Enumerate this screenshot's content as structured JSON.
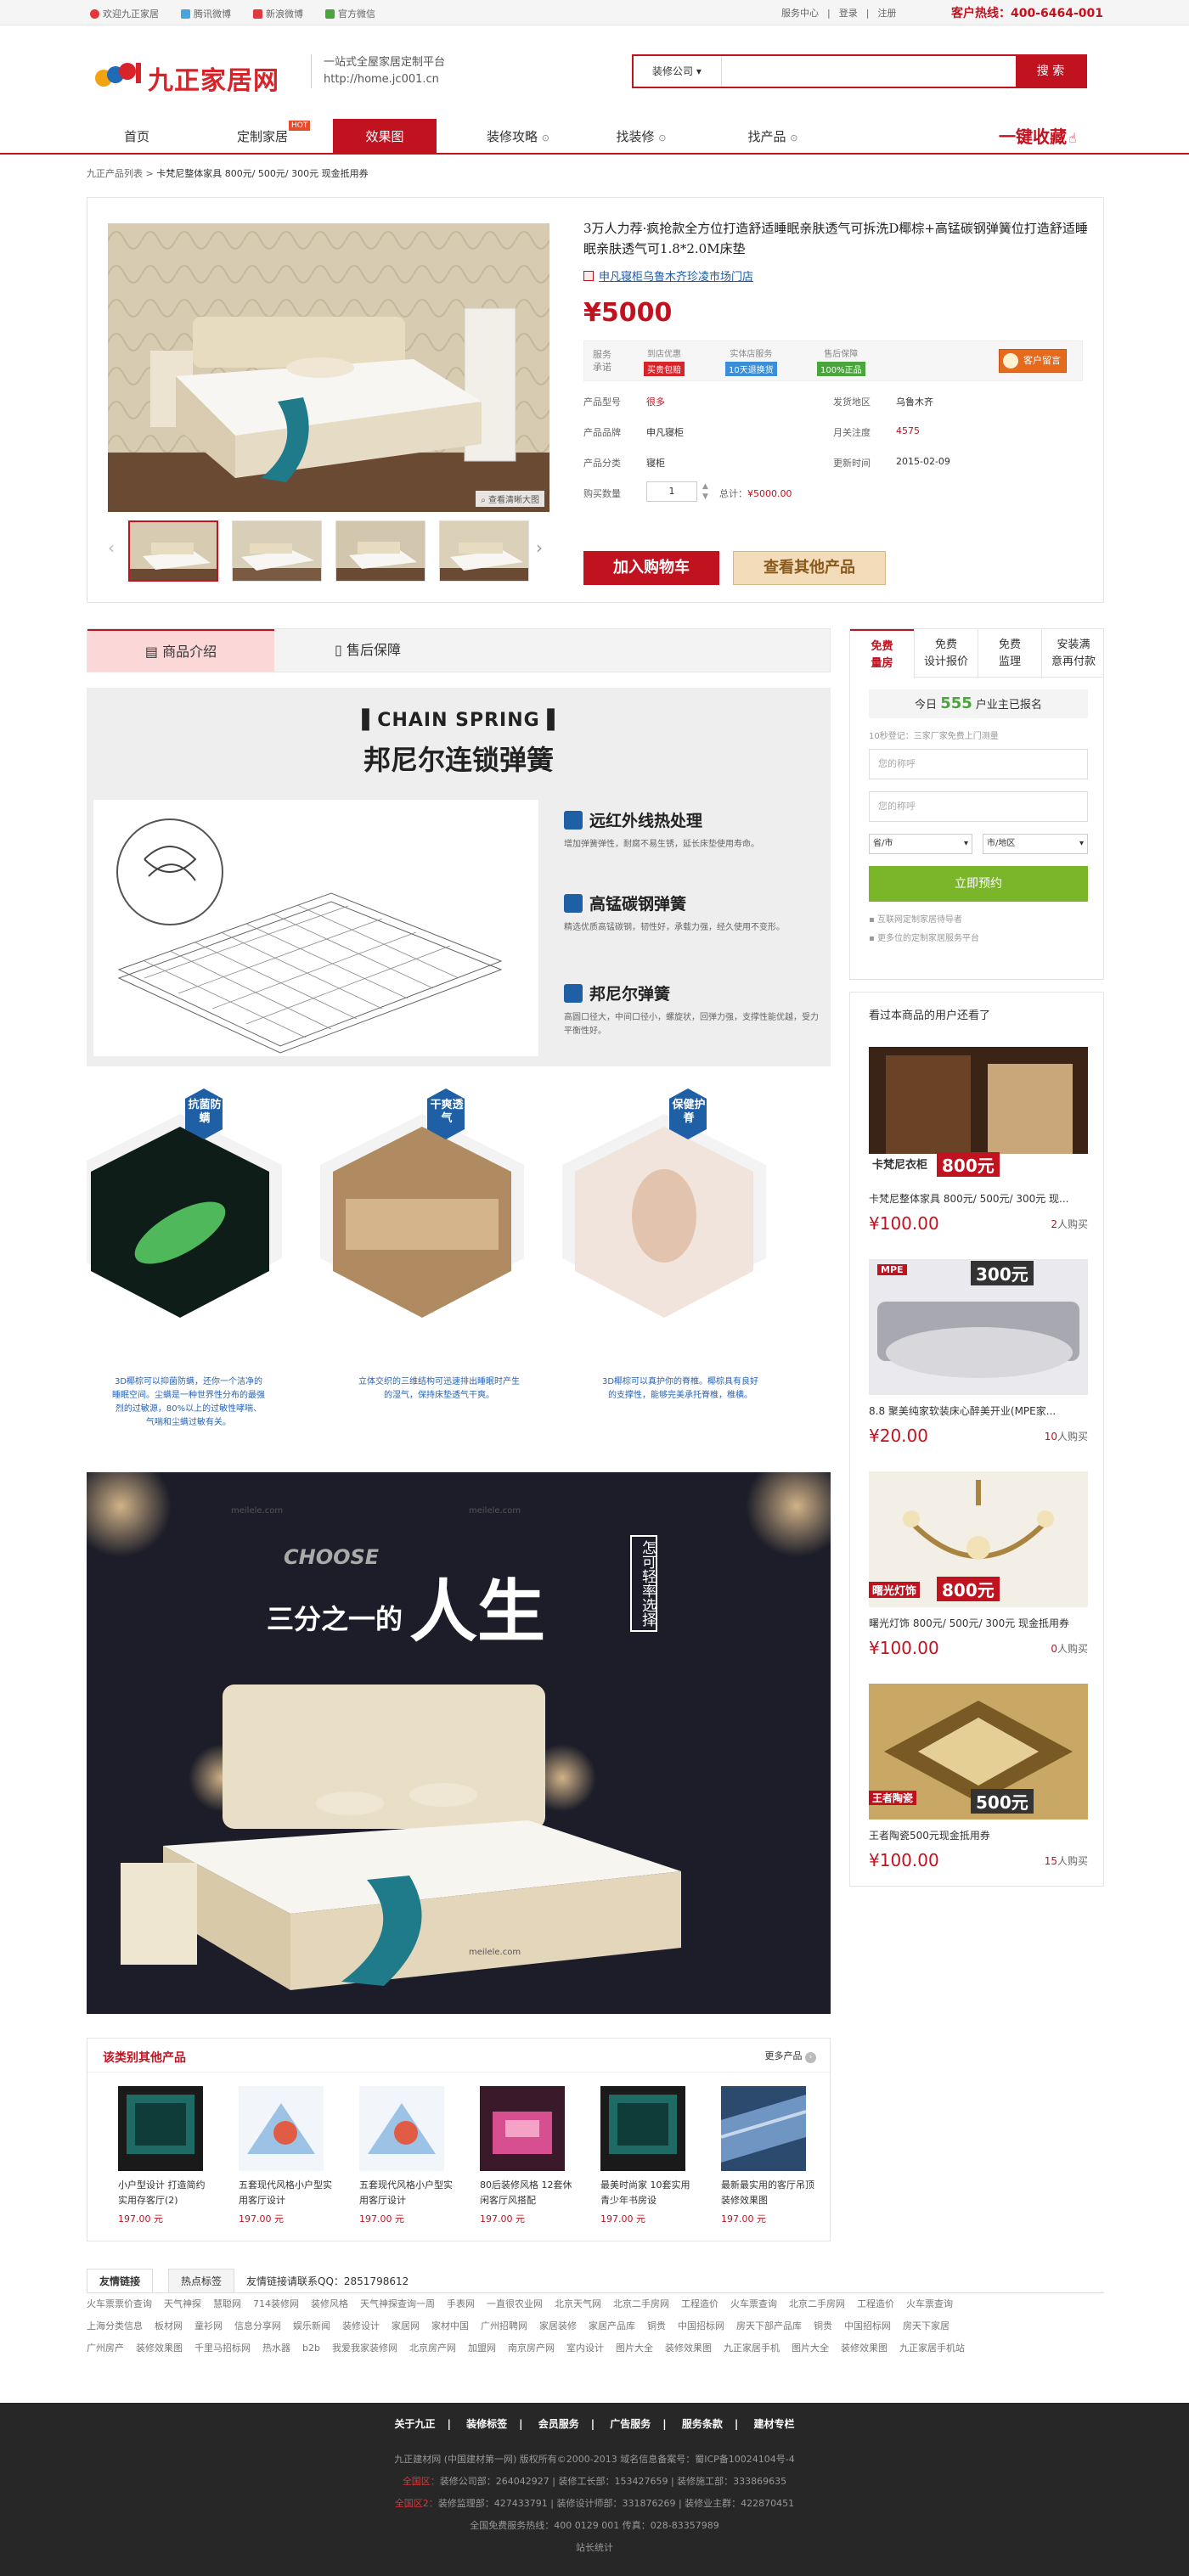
{
  "topbar": {
    "links": [
      "欢迎九正家居",
      "腾讯微博",
      "新浪微博",
      "官方微信"
    ],
    "right_links": [
      "服务中心",
      "登录",
      "注册"
    ],
    "hotline": "客户热线：400-6464-001"
  },
  "header": {
    "logo_text": "九正家居网",
    "slogan_line1": "一站式全屋家居定制平台",
    "slogan_line2": "http://home.jc001.cn",
    "search_category": "装修公司",
    "search_placeholder": "",
    "search_button": "搜 索"
  },
  "nav": {
    "items": [
      "首页",
      "定制家居",
      "效果图",
      "装修攻略",
      "找装修",
      "找产品"
    ],
    "hot_badge": "HOT",
    "collect": "一键收藏"
  },
  "breadcrumb": {
    "root": "九正产品列表",
    "current": "卡梵尼整体家具 800元/ 500元/ 300元 现金抵用券"
  },
  "product": {
    "title": "3万人力荐·疯抢款全方位打造舒适睡眠亲肤透气可拆洗D椰棕+高锰碳钢弹簧位打造舒适睡眠亲肤透气可1.8*2.0M床垫",
    "shop": "申凡寝柜乌鲁木齐珍凌市场门店",
    "price": "¥5000",
    "view_large": "查看清晰大图",
    "service_label": "服务承诺",
    "services": [
      {
        "top": "到店优惠",
        "tag": "买贵包赔",
        "color": "#d8232a"
      },
      {
        "top": "实体店服务",
        "tag": "10天退换货",
        "color": "#3a8fd8"
      },
      {
        "top": "售后保障",
        "tag": "100%正品",
        "color": "#4aa63c"
      }
    ],
    "message_button": "客户留言",
    "attrs": {
      "model_k": "产品型号",
      "model_v": "很多",
      "place_k": "发货地区",
      "place_v": "乌鲁木齐",
      "brand_k": "产品品牌",
      "brand_v": "申凡寝柜",
      "attention_k": "月关注度",
      "attention_v": "4575",
      "category_k": "产品分类",
      "category_v": "寝柜",
      "updated_k": "更新时间",
      "updated_v": "2015-02-09"
    },
    "qty_label": "购买数量",
    "qty": "1",
    "total_label": "总计：",
    "total": "¥5000.00",
    "add_cart": "加入购物车",
    "other_products": "查看其他产品"
  },
  "tabs": {
    "intro": "商品介绍",
    "after": "售后保障"
  },
  "desc1": {
    "en": "CHAIN SPRING",
    "cn": "邦尼尔连锁弹簧",
    "f1_title": "远红外线热处理",
    "f1_text": "增加弹簧弹性，耐腐不易生锈，延长床垫使用寿命。",
    "f2_title": "高锰碳钢弹簧",
    "f2_text": "精选优质高锰碳钢，韧性好，承载力强，经久使用不变形。",
    "f3_title": "邦尼尔弹簧",
    "f3_text": "高圆口径大，中间口径小，螺旋状，回弹力强，支撑性能优越，受力平衡性好。"
  },
  "desc2": {
    "b1": "抗菌防螨",
    "b2": "干爽透气",
    "b3": "保健护脊",
    "t1": "3D椰棕可以抑菌防螨，还你一个洁净的睡眠空间。尘螨是一种世界性分布的最强烈的过敏源，80%以上的过敏性哮喘、气喘和尘螨过敏有关。",
    "t2": "立体交织的三维结构可迅速排出睡眠时产生的湿气，保持床垫透气干爽。",
    "t3": "3D椰棕可以真护你的脊椎。椰棕具有良好的支撑性，能够完美承托脊椎，椎横。"
  },
  "desc3": {
    "choose": "CHOOSE",
    "small": "三分之一的",
    "big": "人生",
    "vertical": "怎可轻率选择",
    "watermark": "meilele.com"
  },
  "side": {
    "tabs": [
      [
        "免费",
        "量房"
      ],
      [
        "免费",
        "设计报价"
      ],
      [
        "免费",
        "监理"
      ],
      [
        "安装满",
        "意再付款"
      ]
    ],
    "today_prefix": "今日",
    "today_count": "555",
    "today_suffix": "户业主已报名",
    "hint": "10秒登记：三家厂家免费上门测量",
    "name_placeholder": "您的称呼",
    "phone_placeholder": "您的称呼",
    "province": "省/市",
    "city": "市/地区",
    "submit": "立即预约",
    "note1": "互联网定制家居待导者",
    "note2": "更多位的定制家居服务平台",
    "seen_title": "看过本商品的用户还看了",
    "seen": [
      {
        "name": "卡梵尼整体家具 800元/ 500元/ 300元 现...",
        "price": "¥100.00",
        "buys": "2",
        "badge": "800元"
      },
      {
        "name": "8.8 聚美纯家软装床心醉美开业(MPE家...",
        "price": "¥20.00",
        "buys": "10",
        "badge": "300元"
      },
      {
        "name": "曙光灯饰 800元/ 500元/ 300元 现金抵用券",
        "price": "¥100.00",
        "buys": "0",
        "badge": "800元"
      },
      {
        "name": "王者陶瓷500元现金抵用券",
        "price": "¥100.00",
        "buys": "15",
        "badge": "500元"
      }
    ],
    "buy_suffix": "人购买"
  },
  "similar": {
    "title": "该类别其他产品",
    "more": "更多产品",
    "items": [
      {
        "name": "小户型设计 打造简约实用存客厅(2)",
        "price": "197.00 元"
      },
      {
        "name": "五套现代风格小户型实用客厅设计",
        "price": "197.00 元"
      },
      {
        "name": "五套现代风格小户型实用客厅设计",
        "price": "197.00 元"
      },
      {
        "name": "80后装修风格 12套休闲客厅风搭配",
        "price": "197.00 元"
      },
      {
        "name": "最美时尚家 10套实用青少年书房设",
        "price": "197.00 元"
      },
      {
        "name": "最新最实用的客厅吊顶装修效果图",
        "price": "197.00 元"
      }
    ]
  },
  "links": {
    "tab1": "友情链接",
    "tab2": "热点标签",
    "contact": "友情链接请联系QQ：2851798612",
    "row1": [
      "火车票票价查询",
      "天气神探",
      "慧聪网",
      "714装修网",
      "装修风格",
      "天气神探查询一周",
      "手表网",
      "一直很农业网",
      "北京天气网",
      "北京二手房网",
      "工程造价",
      "火车票查询",
      "北京二手房网",
      "工程造价",
      "火车票查询"
    ],
    "row2": [
      "上海分类信息",
      "板材网",
      "童衫网",
      "信息分享网",
      "娱乐新闻",
      "装修设计",
      "家居网",
      "家材中国",
      "广州招聘网",
      "家居装修",
      "家居产品库",
      "铜贵",
      "中国招标网",
      "房天下部产品库",
      "铜贵",
      "中国招标网",
      "房天下家居"
    ],
    "row3": [
      "广州房产",
      "装修效果图",
      "千里马招标网",
      "热水器",
      "b2b",
      "我爱我家装修网",
      "北京房产网",
      "加盟网",
      "南京房产网",
      "室内设计",
      "图片大全",
      "装修效果图",
      "九正家居手机",
      "图片大全",
      "装修效果图",
      "九正家居手机站"
    ]
  },
  "footer": {
    "nav": [
      "关于九正",
      "装修标签",
      "会员服务",
      "广告服务",
      "服务条款",
      "建材专栏"
    ],
    "line1": "九正建材网 (中国建材第一网) 版权所有©2000-2013  域名信息备案号：蜀ICP备10024104号-4",
    "l2_label": "全国区：",
    "line2": "装修公司部：264042927 | 装修工长部：153427659 | 装修施工部：333869635",
    "l3_label": "全国区2：",
    "line3": "装修监理部：427433791 | 装修设计师部：331876269 | 装修业主群：422870451",
    "line4": "全国免费服务热线：400 0129 001 传真：028-83357989",
    "line5": "站长统计"
  }
}
